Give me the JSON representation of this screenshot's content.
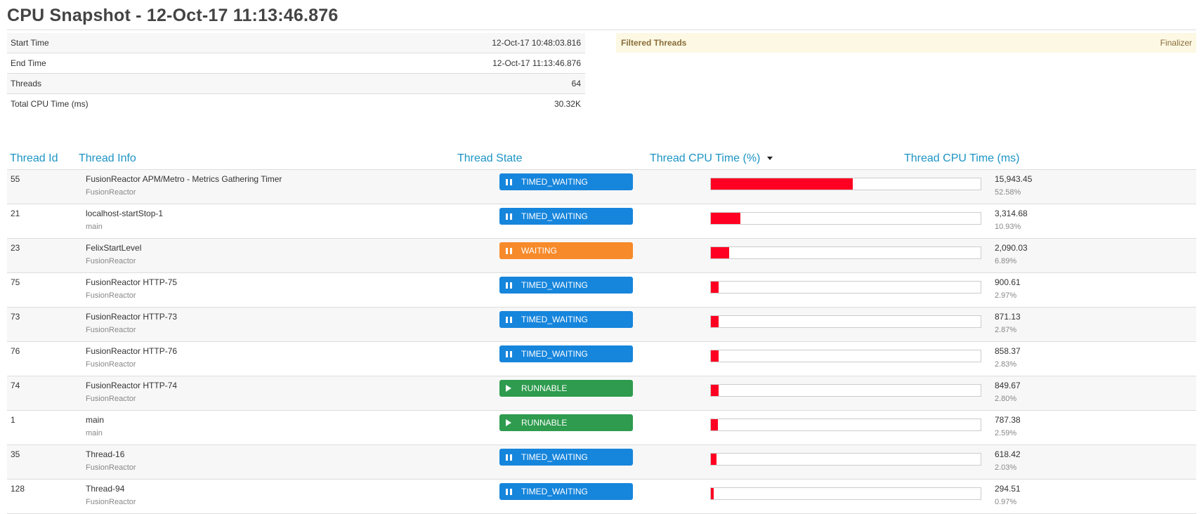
{
  "page": {
    "title": "CPU Snapshot - 12-Oct-17 11:13:46.876"
  },
  "summary": [
    {
      "label": "Start Time",
      "value": "12-Oct-17 10:48:03.816"
    },
    {
      "label": "End Time",
      "value": "12-Oct-17 11:13:46.876"
    },
    {
      "label": "Threads",
      "value": "64"
    },
    {
      "label": "Total CPU Time (ms)",
      "value": "30.32K"
    }
  ],
  "filtered": {
    "label": "Filtered Threads",
    "value": "Finalizer",
    "bg_color": "#fcf8e3",
    "text_color": "#8a6d3b"
  },
  "table": {
    "headers": {
      "id": "Thread Id",
      "info": "Thread Info",
      "state": "Thread State",
      "cpu_pct": "Thread CPU Time (%)",
      "cpu_ms": "Thread CPU Time (ms)"
    },
    "sort_column": "cpu_pct",
    "sort_icon": "caret-down-icon",
    "colors": {
      "header_link": "#1c94c4",
      "bar_fill": "#ff0022"
    },
    "state_styles": {
      "TIMED_WAITING": {
        "color": "#1685dc",
        "icon": "pause-icon"
      },
      "WAITING": {
        "color": "#f78a2a",
        "icon": "pause-icon"
      },
      "RUNNABLE": {
        "color": "#2e9b4e",
        "icon": "play-icon"
      }
    },
    "rows": [
      {
        "id": "55",
        "name": "FusionReactor APM/Metro - Metrics Gathering Timer",
        "group": "FusionReactor",
        "state": "TIMED_WAITING",
        "ms": "15,943.45",
        "pct": "52.58%",
        "fraction": 0.5258
      },
      {
        "id": "21",
        "name": "localhost-startStop-1",
        "group": "main",
        "state": "TIMED_WAITING",
        "ms": "3,314.68",
        "pct": "10.93%",
        "fraction": 0.1093
      },
      {
        "id": "23",
        "name": "FelixStartLevel",
        "group": "FusionReactor",
        "state": "WAITING",
        "ms": "2,090.03",
        "pct": "6.89%",
        "fraction": 0.0689
      },
      {
        "id": "75",
        "name": "FusionReactor HTTP-75",
        "group": "FusionReactor",
        "state": "TIMED_WAITING",
        "ms": "900.61",
        "pct": "2.97%",
        "fraction": 0.0297
      },
      {
        "id": "73",
        "name": "FusionReactor HTTP-73",
        "group": "FusionReactor",
        "state": "TIMED_WAITING",
        "ms": "871.13",
        "pct": "2.87%",
        "fraction": 0.0287
      },
      {
        "id": "76",
        "name": "FusionReactor HTTP-76",
        "group": "FusionReactor",
        "state": "TIMED_WAITING",
        "ms": "858.37",
        "pct": "2.83%",
        "fraction": 0.0283
      },
      {
        "id": "74",
        "name": "FusionReactor HTTP-74",
        "group": "FusionReactor",
        "state": "RUNNABLE",
        "ms": "849.67",
        "pct": "2.80%",
        "fraction": 0.028
      },
      {
        "id": "1",
        "name": "main",
        "group": "main",
        "state": "RUNNABLE",
        "ms": "787.38",
        "pct": "2.59%",
        "fraction": 0.0259
      },
      {
        "id": "35",
        "name": "Thread-16",
        "group": "FusionReactor",
        "state": "TIMED_WAITING",
        "ms": "618.42",
        "pct": "2.03%",
        "fraction": 0.0203
      },
      {
        "id": "128",
        "name": "Thread-94",
        "group": "FusionReactor",
        "state": "TIMED_WAITING",
        "ms": "294.51",
        "pct": "0.97%",
        "fraction": 0.0097
      }
    ]
  }
}
